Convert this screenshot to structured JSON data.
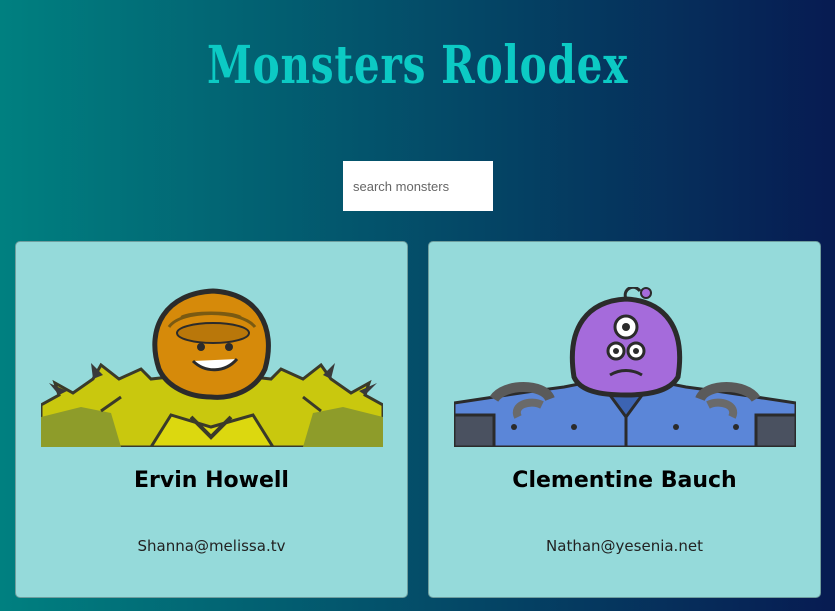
{
  "app": {
    "title": "Monsters Rolodex"
  },
  "search": {
    "placeholder": "search monsters",
    "value": ""
  },
  "monsters": [
    {
      "name": "Ervin Howell",
      "email": "Shanna@melissa.tv",
      "icon": "yellow-armored-monster-icon"
    },
    {
      "name": "Clementine Bauch",
      "email": "Nathan@yesenia.net",
      "icon": "purple-cyclops-robot-monster-icon"
    }
  ],
  "colors": {
    "title": "#0ccac4",
    "card_background": "#95dada",
    "gradient_start": "#008080",
    "gradient_end": "#071b52"
  }
}
